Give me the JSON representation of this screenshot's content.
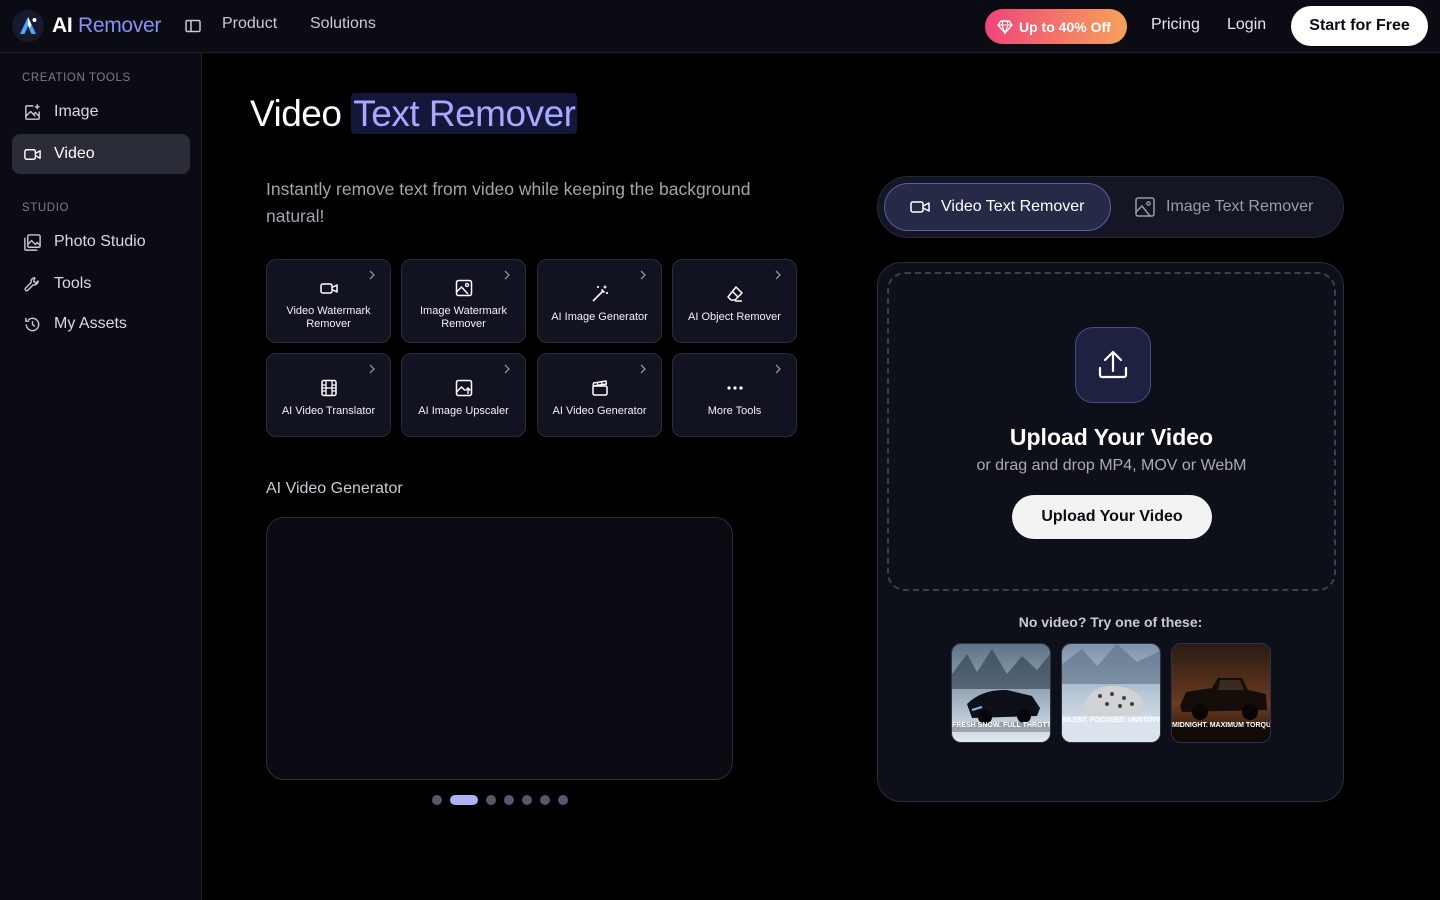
{
  "brand": {
    "name_part1": "AI",
    "name_part2": "Remover"
  },
  "topnav": {
    "links": [
      "Product",
      "Solutions"
    ],
    "promo": "Up to 40% Off",
    "pricing": "Pricing",
    "login": "Login",
    "cta": "Start for Free"
  },
  "sidebar": {
    "sections": [
      {
        "label": "CREATION TOOLS",
        "items": [
          {
            "label": "Image",
            "icon": "image-plus-icon"
          },
          {
            "label": "Video",
            "icon": "video-icon",
            "active": true
          }
        ]
      },
      {
        "label": "STUDIO",
        "items": [
          {
            "label": "Photo Studio",
            "icon": "photo-studio-icon"
          },
          {
            "label": "Tools",
            "icon": "wrench-icon"
          },
          {
            "label": "My Assets",
            "icon": "history-icon"
          }
        ]
      }
    ]
  },
  "main": {
    "title_part1": "Video",
    "title_part2": "Text Remover",
    "subtitle": "Instantly remove text from video while keeping the background natural!",
    "tools": [
      {
        "label": "Video Watermark Remover",
        "icon": "video-icon"
      },
      {
        "label": "Image Watermark Remover",
        "icon": "image-icon"
      },
      {
        "label": "AI Image Generator",
        "icon": "magic-wand-icon"
      },
      {
        "label": "AI Object Remover",
        "icon": "eraser-icon"
      },
      {
        "label": "AI Video Translator",
        "icon": "film-icon"
      },
      {
        "label": "AI Image Upscaler",
        "icon": "image-upscale-icon"
      },
      {
        "label": "AI Video Generator",
        "icon": "clapperboard-icon"
      },
      {
        "label": "More Tools",
        "icon": "more-dots-icon"
      }
    ],
    "generator_label": "AI Video Generator",
    "carousel": {
      "count": 7,
      "active_index": 1
    }
  },
  "panel": {
    "tabs": [
      {
        "label": "Video Text Remover",
        "icon": "video-icon",
        "active": true
      },
      {
        "label": "Image Text Remover",
        "icon": "image-icon",
        "active": false
      }
    ],
    "upload": {
      "title": "Upload Your Video",
      "subtitle": "or drag and drop MP4, MOV or WebM",
      "button": "Upload Your Video"
    },
    "samples_label": "No video? Try one of these:",
    "samples": [
      {
        "caption": "FRESH SNOW. FULL THROTTLE."
      },
      {
        "caption": "SILENT. FOCUSED. UNSTOPPABLE."
      },
      {
        "caption": "MIDNIGHT. MAXIMUM TORQUE."
      }
    ]
  },
  "colors": {
    "accent": "#8b8ff5",
    "background": "#000000",
    "sidebar": "#0b0c13",
    "promo_start": "#f0457a",
    "promo_end": "#f6a25a"
  }
}
